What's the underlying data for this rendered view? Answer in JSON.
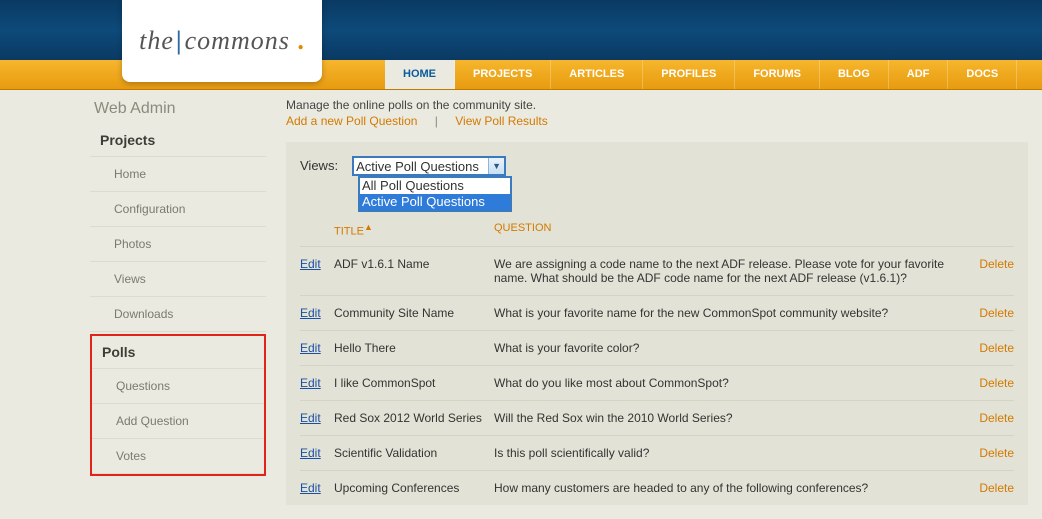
{
  "logo": {
    "prefix": "the",
    "main": "commons"
  },
  "nav": {
    "items": [
      {
        "label": "HOME",
        "active": true
      },
      {
        "label": "PROJECTS"
      },
      {
        "label": "ARTICLES"
      },
      {
        "label": "PROFILES"
      },
      {
        "label": "FORUMS"
      },
      {
        "label": "BLOG"
      },
      {
        "label": "ADF"
      },
      {
        "label": "DOCS"
      }
    ]
  },
  "sidebar": {
    "title": "Web Admin",
    "groups": [
      {
        "heading": "Projects",
        "highlight": false,
        "items": [
          "Home",
          "Configuration",
          "Photos",
          "Views",
          "Downloads"
        ]
      },
      {
        "heading": "Polls",
        "highlight": true,
        "items": [
          "Questions",
          "Add Question",
          "Votes"
        ]
      }
    ]
  },
  "intro": "Manage the online polls on the community site.",
  "toplinks": {
    "add": "Add a new Poll Question",
    "view": "View Poll Results"
  },
  "views": {
    "label": "Views:",
    "selected": "Active Poll Questions",
    "options": [
      "All Poll Questions",
      "Active Poll Questions"
    ],
    "highlighted_index": 1
  },
  "grid": {
    "headers": {
      "title": "TITLE",
      "question": "QUESTION"
    },
    "edit_label": "Edit",
    "delete_label": "Delete",
    "rows": [
      {
        "title": "ADF v1.6.1 Name",
        "question": "We are assigning a code name to the next ADF release. Please vote for your favorite name. What should be the ADF code name for the next ADF release (v1.6.1)?"
      },
      {
        "title": "Community Site Name",
        "question": "What is your favorite name for the new CommonSpot community website?"
      },
      {
        "title": "Hello There",
        "question": "What is your favorite color?"
      },
      {
        "title": "I like CommonSpot",
        "question": "What do you like most about CommonSpot?"
      },
      {
        "title": "Red Sox 2012 World Series",
        "question": "Will the Red Sox win the 2010 World Series?"
      },
      {
        "title": "Scientific Validation",
        "question": "Is this poll scientifically valid?"
      },
      {
        "title": "Upcoming Conferences",
        "question": "How many customers are headed to any of the following conferences?"
      }
    ]
  }
}
